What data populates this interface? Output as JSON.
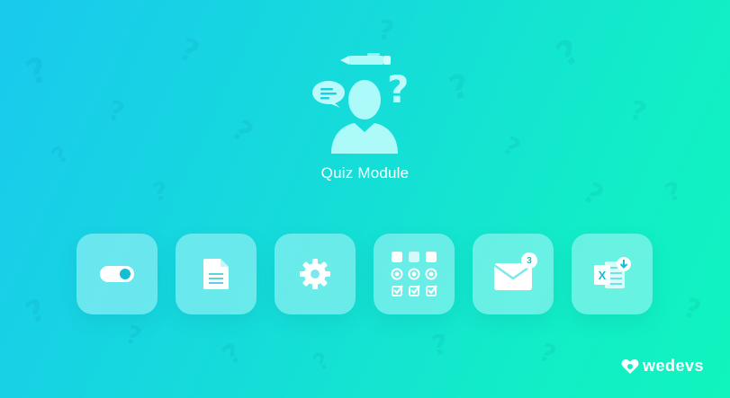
{
  "module": {
    "title": "Quiz Module",
    "icon": "quiz-person-icon"
  },
  "tiles": [
    {
      "icon": "toggle-switch-icon"
    },
    {
      "icon": "document-icon"
    },
    {
      "icon": "gear-icon"
    },
    {
      "icon": "quiz-grid-icon"
    },
    {
      "icon": "envelope-icon",
      "badge": "3"
    },
    {
      "icon": "excel-download-icon"
    }
  ],
  "brand": {
    "name": "wedevs",
    "icon": "wedevs-logo-icon"
  },
  "colors": {
    "gradient_start": "#19c9ee",
    "gradient_end": "#10f4bd",
    "tile": "#aff5fa",
    "accent": "#14bfd5"
  }
}
